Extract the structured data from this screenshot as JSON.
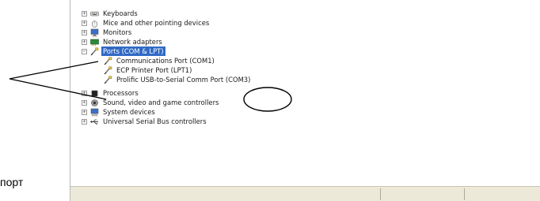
{
  "tree": {
    "items": [
      {
        "label": "Keyboards",
        "expander": "+",
        "icon": "keyboard-icon"
      },
      {
        "label": "Mice and other pointing devices",
        "expander": "+",
        "icon": "mouse-icon"
      },
      {
        "label": "Monitors",
        "expander": "+",
        "icon": "monitor-icon"
      },
      {
        "label": "Network adapters",
        "expander": "+",
        "icon": "network-adapter-icon"
      },
      {
        "label": "Ports (COM & LPT)",
        "expander": "−",
        "icon": "port-icon",
        "selected": true
      },
      {
        "label": "Communications Port (COM1)",
        "icon": "port-icon"
      },
      {
        "label": "ECP Printer Port (LPT1)",
        "icon": "port-icon"
      },
      {
        "label": "Prolific USB-to-Serial Comm Port (COM3)",
        "icon": "port-icon"
      },
      {
        "label": "Processors",
        "expander": "+",
        "icon": "processor-icon"
      },
      {
        "label": "Sound, video and game controllers",
        "expander": "+",
        "icon": "sound-icon"
      },
      {
        "label": "System devices",
        "expander": "+",
        "icon": "system-devices-icon"
      },
      {
        "label": "Universal Serial Bus controllers",
        "expander": "+",
        "icon": "usb-icon"
      }
    ]
  },
  "caption": "порт",
  "colors": {
    "selection": "#316ac5",
    "statusbar": "#ece9d8"
  }
}
